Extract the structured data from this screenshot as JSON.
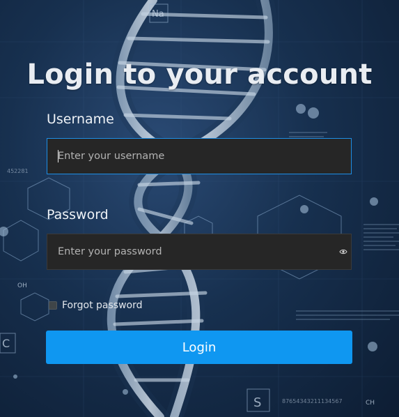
{
  "page": {
    "title": "Login to your account"
  },
  "form": {
    "username_label": "Username",
    "username_placeholder": "Enter your username",
    "username_value": "",
    "password_label": "Password",
    "password_placeholder": "Enter your password",
    "password_value": "",
    "forgot_label": "Forgot password",
    "login_label": "Login"
  },
  "background": {
    "element_na": "Na",
    "element_s": "S",
    "element_c": "C",
    "element_ch": "CH",
    "element_oh": "OH",
    "number_string": "87654343211134567",
    "number_left": "452281"
  },
  "icons": {
    "password_toggle": "eye-icon",
    "helix": "dna-helix-icon"
  },
  "colors": {
    "primary": "#0f97f1",
    "focus_border": "#1e8fe6",
    "field_bg": "#262626",
    "text": "#e9edf2"
  }
}
